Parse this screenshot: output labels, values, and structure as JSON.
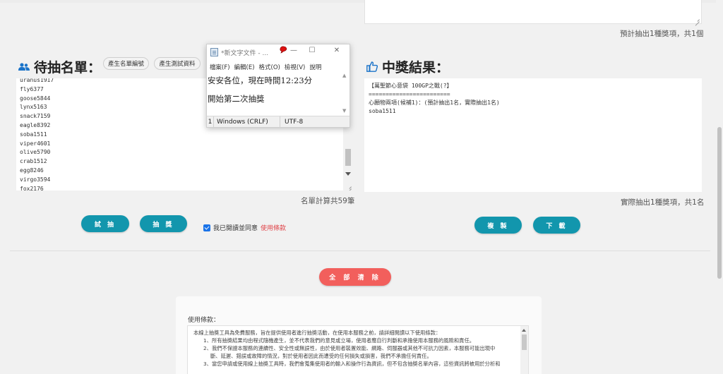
{
  "top_right": {
    "summary": "預計抽出1種獎項，共1個"
  },
  "participants": {
    "title": "待抽名單：",
    "buttons": {
      "generate_numbers": "產生名單編號",
      "generate_test": "產生測試資料"
    },
    "names": [
      "uranus1917",
      "fly6377",
      "goose5844",
      "lynx5163",
      "snack7159",
      "eagle8392",
      "soba1511",
      "viper4601",
      "olive5790",
      "crab1512",
      "egg8246",
      "virgo3594",
      "fox2176"
    ],
    "count_label": "名單計算共59筆"
  },
  "results": {
    "title": "中獎結果：",
    "text": "【萬聖節心意袋 100GP之戰(?】\n========================\n心願物兩項(候補1)：(預計抽出1名，實際抽出1名)\nsoba1511",
    "summary": "實際抽出1種獎項，共1名"
  },
  "actions": {
    "trial_draw": "試 抽",
    "draw": "抽 獎",
    "agree_text": "我已閱讀並同意",
    "agree_link": "使用條款",
    "agree_checked": true,
    "copy": "複 製",
    "download": "下 載",
    "clear_all": "全 部 清 除"
  },
  "terms": {
    "title": "使用條款：",
    "lines": [
      "本線上抽獎工具為免費服務，旨在提供使用者進行抽獎活動，在使用本服務之前，請詳細閱讀以下使用條款：",
      "1、所有抽獎結果均由程式隨機產生，並不代表我們的意見或立場，使用者應自行判斷和承擔使用本服務的風險和責任。",
      "2、我們不保證本服務的連續性、安全性或無誤性，由於使用者裝置效能、網路、伺服器或其他不可抗力因素，本服務可能出現中",
      "斷、延遲、錯誤或故障的情況，對於使用者因此而遭受的任何損失或損害，我們不承擔任何責任。",
      "3、當您申請或使用線上抽獎工具時，我們會蒐集使用者的輸入和操作行為資訊，但不包含抽獎名單內容，這些資訊將被用於分析和"
    ]
  },
  "notepad": {
    "title": "*新文字文件 - ...",
    "menu": [
      "檔案(F)",
      "編輯(E)",
      "格式(O)",
      "檢視(V)",
      "說明"
    ],
    "lines": [
      "安安各位，現在時間12:23分",
      "開始第二次抽獎"
    ],
    "status": {
      "line": "1",
      "eol": "Windows (CRLF)",
      "encoding": "UTF-8"
    }
  },
  "colors": {
    "accent_teal": "#1296ad",
    "danger_red": "#f25f5c",
    "link_red": "#e0454a",
    "title_icon_blue": "#1a73c9"
  }
}
